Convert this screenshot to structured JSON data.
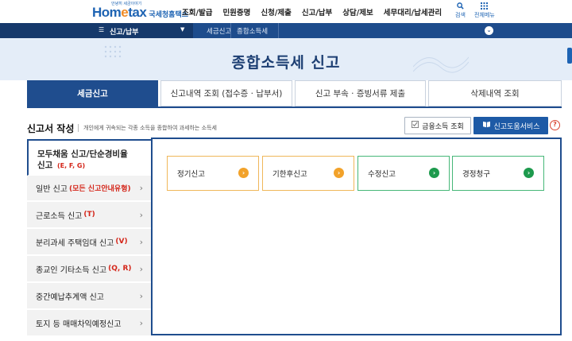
{
  "header": {
    "logo_small": "안녕히 세금이야기",
    "logo_main_a": "Hom",
    "logo_main_b": "e",
    "logo_main_c": "tax",
    "logo_sub": "국세청홈택스",
    "gnb": [
      "조회/발급",
      "민원증명",
      "신청/제출",
      "신고/납부",
      "상담/제보",
      "세무대리/납세관리"
    ],
    "search_label": "검색",
    "allmenu_label": "전체메뉴"
  },
  "navbar": {
    "menu_label": "신고/납부",
    "crumbs": [
      "세금신고",
      "종합소득세"
    ]
  },
  "hero": {
    "title": "종합소득세 신고"
  },
  "tabs": [
    "세금신고",
    "신고내역 조회 (접수증 · 납부서)",
    "신고 부속 · 증빙서류 제출",
    "삭제내역 조회"
  ],
  "section": {
    "title": "신고서 작성",
    "desc": "개인에게 귀속되는 각종 소득을 종합하여 과세하는 소득세",
    "btn_financial": "금융소득 조회",
    "btn_help": "신고도움서비스",
    "help_icon": "?"
  },
  "leftmenu": [
    {
      "label": "모두채움 신고/단순경비율",
      "label2": "신고",
      "code": "(E, F, G)"
    },
    {
      "label": "일반 신고",
      "code": "(모든 신고안내유형)"
    },
    {
      "label": "근로소득 신고",
      "code": "(T)"
    },
    {
      "label": "분리과세 주택임대 신고",
      "code": "(V)"
    },
    {
      "label": "종교인 기타소득 신고",
      "code": "(Q, R)"
    },
    {
      "label": "중간예납추계액 신고",
      "code": ""
    },
    {
      "label": "토지 등 매매차익예정신고",
      "code": ""
    }
  ],
  "cards": [
    {
      "label": "정기신고",
      "color": "orange"
    },
    {
      "label": "기한후신고",
      "color": "orange"
    },
    {
      "label": "수정신고",
      "color": "green"
    },
    {
      "label": "경정청구",
      "color": "green"
    }
  ],
  "icons": {
    "search": "search-icon",
    "allmenu": "grid-icon",
    "menu": "hamburger-icon",
    "chevron": "chevron-right-icon",
    "book": "book-icon",
    "checkbox": "check-doc-icon"
  },
  "colors": {
    "primary": "#1f4d8e",
    "accent": "#1d63b3",
    "orange": "#f2a22a",
    "green": "#1d9a4d",
    "red": "#d4261a"
  }
}
